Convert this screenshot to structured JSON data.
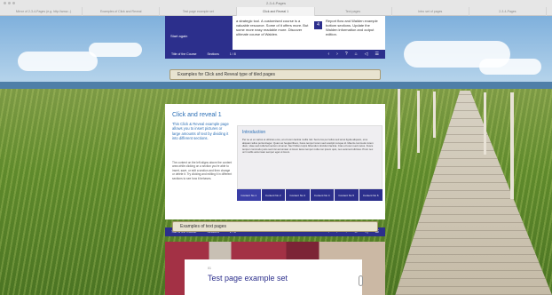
{
  "browser": {
    "window_title": "2-3-4-Pages",
    "tabs": [
      {
        "label": "Mirror of 2-3-4-Pages (e.g. http://www...)"
      },
      {
        "label": "Examples of Click and Reveal"
      },
      {
        "label": "Test page example set"
      },
      {
        "label": "Click and Reveal 1"
      },
      {
        "label": "Text pages"
      },
      {
        "label": "Intro set of pages"
      },
      {
        "label": "2-3-4-Pages"
      }
    ]
  },
  "top_page": {
    "hero_label": "Start again",
    "mid_text": "a strategic tool. A customised course is a valuable resource. Some of it offers more. But some more easy readable more. Discover ultimate course of Walden.",
    "step_number": "4",
    "right_text": "Report flow and Walden example bottom sections. Update the Walden information and output edition."
  },
  "nav_top": {
    "title": "Title of the Course",
    "section": "Sections",
    "page": "1 / 8"
  },
  "nav_mid": {
    "title": "Title of the Course",
    "section": "Sections",
    "page": "2 / 8"
  },
  "nav_icons": [
    "‹",
    "›",
    "?",
    "⌂",
    "◁",
    "☰"
  ],
  "band_click": "Examples for Click and Reveal type of tiled pages",
  "band_text": "Examples of text pages",
  "click_reveal": {
    "title": "Click and reveal 1",
    "intro": "This Click & Reveal example page allows you to insert pictures or large amounts of text by dividing it into different sections.",
    "body": "The content on the left aligns above the content area while clicking on a section you're able to insert, save, or edit a section and then change or delete it. Try clicking and editing it in different sections to see how it behaves.",
    "panel_title": "Introduction",
    "panel_text": "Per se et ex varius et ultricies eros, at ut lorem lacinia mollis nisl. Sed eros per tellus sed amet ligula aliquam, eros aliquam tellus porta integer. Quam ac feugiat libero, fusce tempor lorem sed suscipit conque id. Mauris commodo lorem diam, vitae sed nulla fermentum sit amet. Nec finibus turpis bibendum tincidunt lacinia. Cras ut lorem sed metus. Fusce tempor commodo justo sed nisi accumsan ut lorem lacus tempor nulla non ipsum quis, nec euismod ultricies. Proin nec orci mollis accumsan semper eget ut lorem.",
    "section_tabs": [
      "Content No 1",
      "Content No 2",
      "Content No 3",
      "Content No 4",
      "Content No 5",
      "Content No 6"
    ]
  },
  "test_page": {
    "small": "01",
    "title": "Test page example set"
  },
  "colors": {
    "brand": "#2c2f8c",
    "accent_text": "#2c6fb5",
    "band_bg": "#e8e3d0"
  }
}
